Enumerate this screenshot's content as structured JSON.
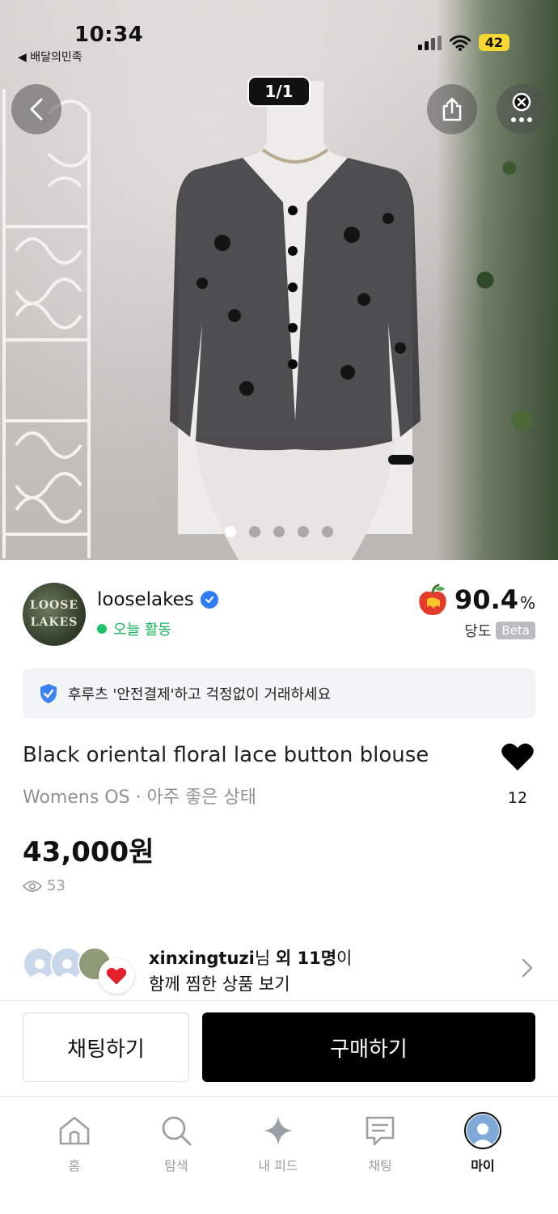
{
  "status_bar": {
    "time": "10:34",
    "back_label": "◀ 배달의민족",
    "battery": "42"
  },
  "gallery": {
    "counter": "1/1",
    "page_count": 5,
    "active_page": 1
  },
  "seller": {
    "avatar_text_line1": "LOOSE",
    "avatar_text_line2": "LAKES",
    "name": "looselakes",
    "activity": "오늘 활동",
    "score_value": "90.4",
    "score_unit": "%",
    "score_label": "당도",
    "score_badge": "Beta"
  },
  "safe_banner": {
    "text": "후루츠 '안전결제'하고 걱정없이 거래하세요"
  },
  "product": {
    "title": "Black oriental floral lace button blouse",
    "subtitle": "Womens OS · 아주 좋은 상태",
    "price": "43,000원",
    "views": "53",
    "likes": "12"
  },
  "wishers": {
    "lead_user": "xinxingtuzi",
    "lead_suffix": "님 ",
    "others": "외 11명",
    "others_suffix": "이",
    "line2": "함께 찜한 상품 보기"
  },
  "actions": {
    "chat_label": "채팅하기",
    "buy_label": "구매하기"
  },
  "tabbar": {
    "items": [
      {
        "label": "홈",
        "icon": "home-icon"
      },
      {
        "label": "탐색",
        "icon": "search-icon"
      },
      {
        "label": "내 피드",
        "icon": "sparkle-icon"
      },
      {
        "label": "채팅",
        "icon": "chat-icon"
      },
      {
        "label": "마이",
        "icon": "profile-avatar-icon"
      }
    ],
    "active": "마이"
  },
  "colors": {
    "accent_green": "#16b35a",
    "verified_blue": "#2f7cf6",
    "buy_button": "#000000",
    "battery": "#f7d731"
  }
}
